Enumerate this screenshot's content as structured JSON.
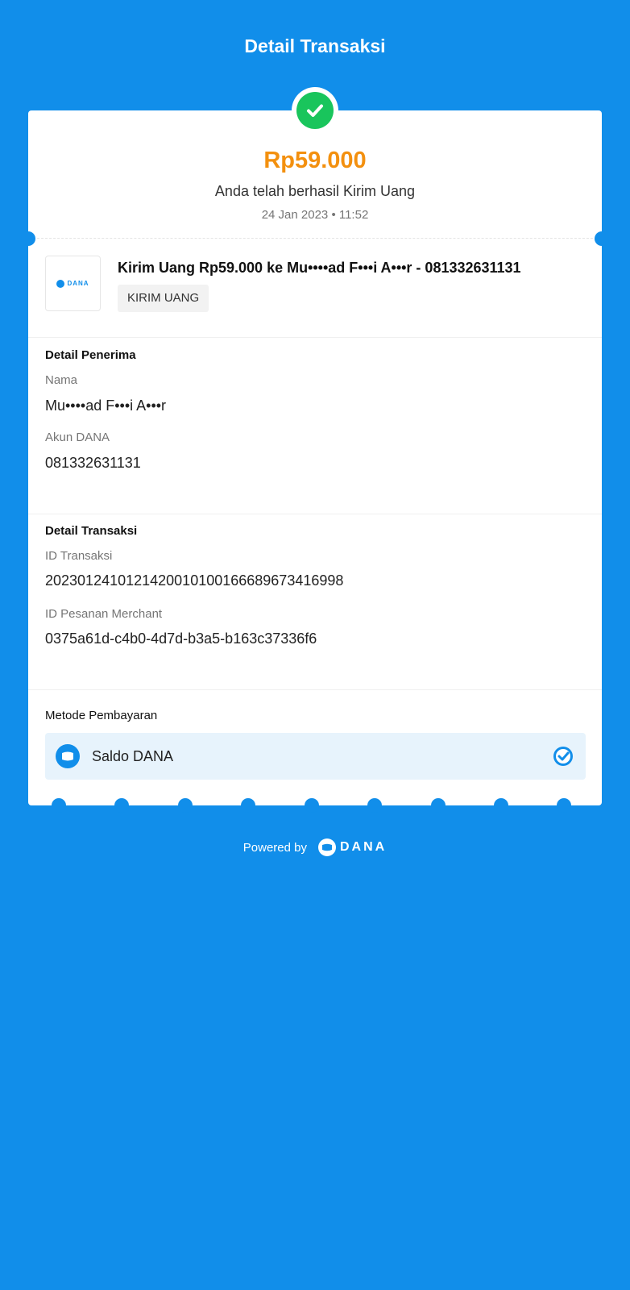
{
  "header": {
    "title": "Detail Transaksi"
  },
  "summary": {
    "amount": "Rp59.000",
    "message": "Anda telah berhasil Kirim Uang",
    "datetime": "24 Jan 2023 • 11:52",
    "status_icon": "check-icon",
    "status_color": "#19c55c",
    "amount_color": "#f3900f"
  },
  "transaction": {
    "logo_text": "DANA",
    "title": "Kirim Uang Rp59.000 ke Mu••••ad F•••i A•••r - 081332631131",
    "tag": "KIRIM UANG"
  },
  "recipient": {
    "section_title": "Detail Penerima",
    "name_label": "Nama",
    "name_value": "Mu••••ad F•••i A•••r",
    "account_label": "Akun DANA",
    "account_value": "081332631131"
  },
  "details": {
    "section_title": "Detail Transaksi",
    "id_label": "ID Transaksi",
    "id_value": "2023012410121420010100166689673416998",
    "merchant_label": "ID Pesanan Merchant",
    "merchant_value": "0375a61d-c4b0-4d7d-b3a5-b163c37336f6"
  },
  "payment": {
    "title": "Metode Pembayaran",
    "method": "Saldo DANA",
    "method_icon": "wallet-icon",
    "selected_icon": "check-circle-icon"
  },
  "footer": {
    "powered_by": "Powered by",
    "brand": "DANA"
  },
  "colors": {
    "background": "#118eea",
    "card": "#ffffff",
    "payment_box": "#e7f3fc"
  }
}
